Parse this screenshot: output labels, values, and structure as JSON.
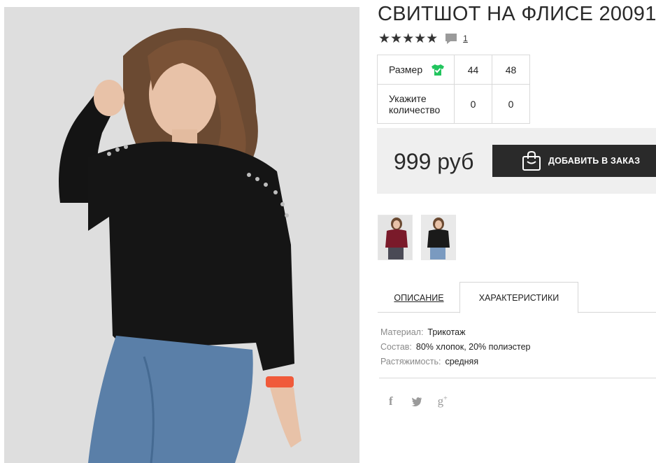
{
  "product": {
    "title": "СВИТШОТ НА ФЛИСЕ 20091",
    "stars": "★★★★★",
    "review_count": "1"
  },
  "sizes": {
    "size_label": "Размер",
    "size_options": [
      "44",
      "48"
    ],
    "qty_label": "Укажите количество",
    "quantities": [
      "0",
      "0"
    ]
  },
  "purchase": {
    "price": "999 руб",
    "order_button": "ДОБАВИТЬ В ЗАКАЗ"
  },
  "tabs": {
    "description": "ОПИСАНИЕ",
    "specs": "ХАРАКТЕРИСТИКИ"
  },
  "specs": [
    {
      "key": "Материал:",
      "value": "Трикотаж"
    },
    {
      "key": "Состав:",
      "value": "80% хлопок, 20% полиэстер"
    },
    {
      "key": "Растяжимость:",
      "value": "средняя"
    }
  ],
  "colors": {
    "accent_green": "#22c55e",
    "dark": "#2a2a2a",
    "price_bg": "#efefef"
  },
  "icons": [
    "comment-icon",
    "tshirt-check-icon",
    "shopping-bag-icon",
    "facebook-icon",
    "twitter-icon",
    "google-plus-icon"
  ]
}
